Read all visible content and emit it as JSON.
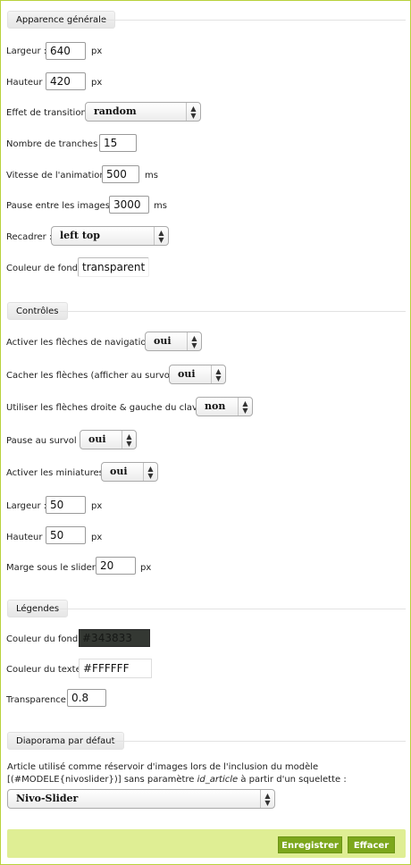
{
  "sections": {
    "general": {
      "title": "Apparence générale",
      "width_label": "Largeur :",
      "width_value": "640",
      "width_unit": "px",
      "height_label": "Hauteur :",
      "height_value": "420",
      "height_unit": "px",
      "transition_label": "Effet de transition :",
      "transition_value": "random",
      "slices_label": "Nombre de tranches :",
      "slices_value": "15",
      "speed_label": "Vitesse de l'animation :",
      "speed_value": "500",
      "speed_unit": "ms",
      "pause_label": "Pause entre les images :",
      "pause_value": "3000",
      "pause_unit": "ms",
      "crop_label": "Recadrer :",
      "crop_value": "left top",
      "bg_label": "Couleur de fond :",
      "bg_value": "transparent"
    },
    "controls": {
      "title": "Contrôles",
      "nav_arrows_label": "Activer les flèches de navigation :",
      "nav_arrows_value": "oui",
      "hide_arrows_label": "Cacher les flèches (afficher au survol) :",
      "hide_arrows_value": "oui",
      "keyboard_label": "Utiliser les flèches droite & gauche du clavier :",
      "keyboard_value": "non",
      "hover_pause_label": "Pause au survol :",
      "hover_pause_value": "oui",
      "thumbs_label": "Activer les miniatures :",
      "thumbs_value": "oui",
      "thumb_width_label": "Largeur :",
      "thumb_width_value": "50",
      "thumb_width_unit": "px",
      "thumb_height_label": "Hauteur :",
      "thumb_height_value": "50",
      "thumb_height_unit": "px",
      "margin_label": "Marge sous le slider :",
      "margin_value": "20",
      "margin_unit": "px"
    },
    "captions": {
      "title": "Légendes",
      "bg_color_label": "Couleur du fond :",
      "bg_color_value": "#343833",
      "text_color_label": "Couleur du texte :",
      "text_color_value": "#FFFFFF",
      "transparency_label": "Transparence :",
      "transparency_value": "0.8"
    },
    "default_slideshow": {
      "title": "Diaporama par défaut",
      "description_pre": "Article utilisé comme réservoir d'images lors de l'inclusion du modèle [(#MODELE{nivoslider})] sans paramètre ",
      "description_em": "id_article",
      "description_post": " à partir d'un squelette :",
      "article_value": "Nivo-Slider"
    }
  },
  "buttons": {
    "save": "Enregistrer",
    "clear": "Effacer"
  },
  "colors": {
    "accent": "#7ca71c",
    "footer_bg": "#dfee94",
    "frame_border": "#b8d23c",
    "caption_bg": "#343833",
    "caption_text": "#FFFFFF"
  }
}
